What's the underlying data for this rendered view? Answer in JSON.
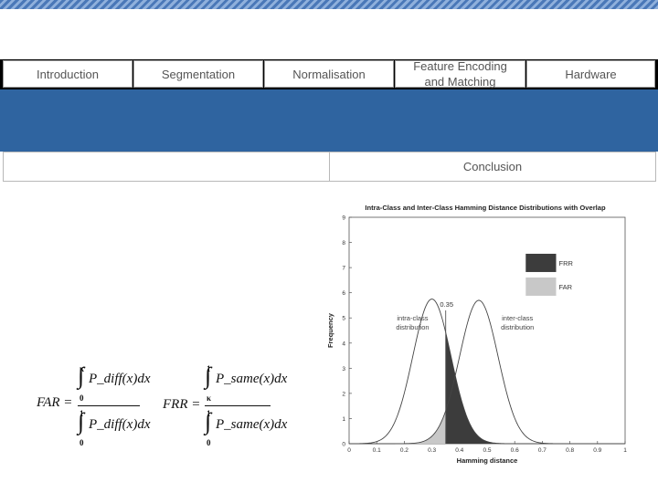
{
  "nav": {
    "items": [
      "Introduction",
      "Segmentation",
      "Normalisation",
      "Feature Encoding and Matching",
      "Hardware"
    ]
  },
  "sub_nav": {
    "conclusion_label": "Conclusion"
  },
  "formulas": {
    "far": {
      "lhs": "FAR =",
      "numerator": "P_diff(x)dx",
      "numerator_upper": "κ",
      "numerator_lower": "0",
      "denominator": "P_diff(x)dx",
      "denominator_upper": "1",
      "denominator_lower": "0"
    },
    "frr": {
      "lhs": "FRR =",
      "numerator": "P_same(x)dx",
      "numerator_upper": "1",
      "numerator_lower": "κ",
      "denominator": "P_same(x)dx",
      "denominator_upper": "1",
      "denominator_lower": "0"
    }
  },
  "chart_data": {
    "type": "line",
    "title": "Intra-Class and Inter-Class Hamming Distance Distributions with Overlap",
    "xlabel": "Hamming distance",
    "ylabel": "Frequency",
    "xlim": [
      0,
      1
    ],
    "ylim": [
      0,
      9
    ],
    "xticks": [
      "0",
      "0.1",
      "0.2",
      "0.3",
      "0.4",
      "0.5",
      "0.6",
      "0.7",
      "0.8",
      "0.9",
      "1"
    ],
    "yticks": [
      "0",
      "1",
      "2",
      "3",
      "4",
      "5",
      "6",
      "7",
      "8",
      "9"
    ],
    "threshold": 0.35,
    "threshold_label": "0.35",
    "grid": false,
    "series": [
      {
        "name": "intra-class distribution",
        "label_lines": [
          "intra-class",
          "distribution"
        ],
        "mean": 0.3,
        "sd": 0.069,
        "peak": 5.75,
        "fill_above": 0.35,
        "fill_color": "#3c3c3c"
      },
      {
        "name": "inter-class distribution",
        "label_lines": [
          "inter-class",
          "distribution"
        ],
        "mean": 0.47,
        "sd": 0.07,
        "peak": 5.7,
        "fill_below": 0.35,
        "fill_color": "#c8c8c8"
      }
    ],
    "legend": [
      {
        "label": "FRR",
        "color": "#3c3c3c"
      },
      {
        "label": "FAR",
        "color": "#c8c8c8"
      }
    ],
    "legend_position": "top-right"
  }
}
